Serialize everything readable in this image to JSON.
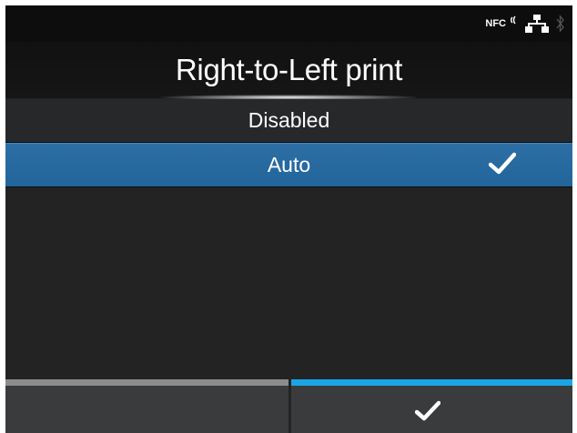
{
  "status": {
    "nfc_label": "NFC",
    "icons": [
      "nfc-icon",
      "network-icon",
      "bluetooth-icon"
    ]
  },
  "title": "Right-to-Left print",
  "options": [
    {
      "label": "Disabled",
      "selected": false
    },
    {
      "label": "Auto",
      "selected": true
    }
  ],
  "softkeys": {
    "left": {
      "label": "",
      "bar_color": "#8c8c8c"
    },
    "right": {
      "icon": "checkmark-icon",
      "bar_color": "#1aa6e6"
    }
  },
  "colors": {
    "selection": "#2669a0",
    "background": "#232324"
  }
}
